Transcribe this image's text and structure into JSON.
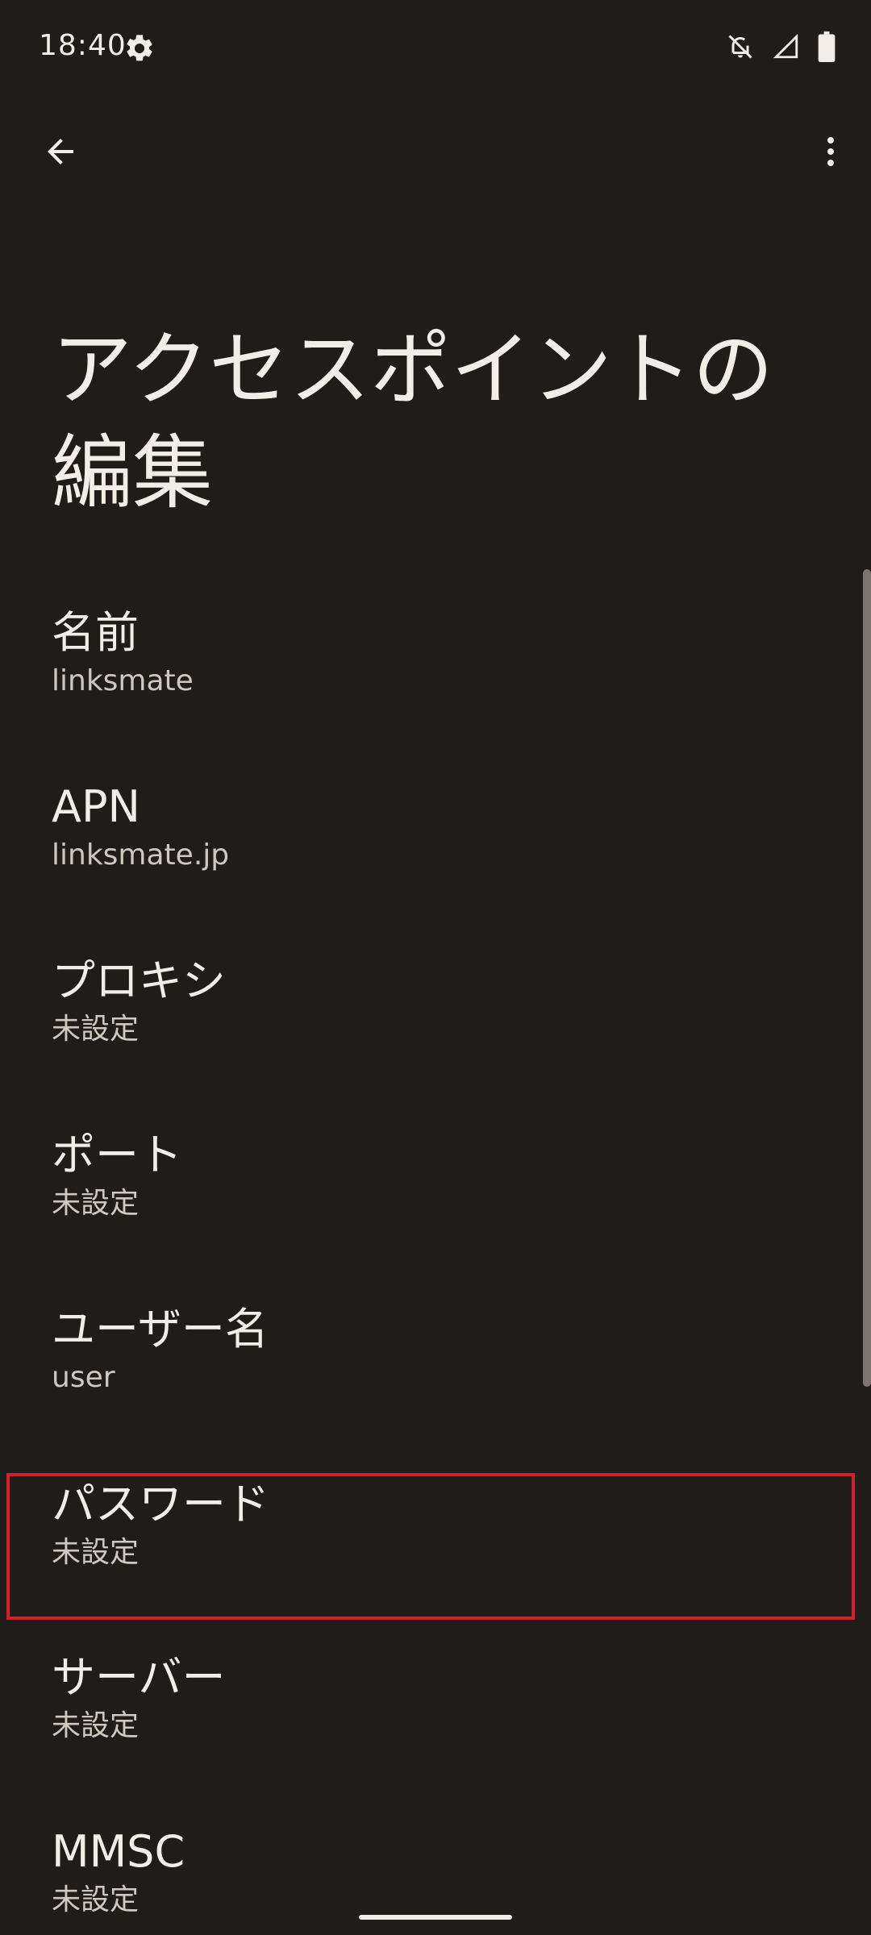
{
  "status_bar": {
    "time": "18:40",
    "icons": [
      "gear-icon",
      "notifications-off-icon",
      "signal-icon",
      "battery-icon"
    ]
  },
  "app_bar": {
    "back_icon": "arrow-back-icon",
    "more_icon": "more-vert-icon"
  },
  "page": {
    "title": "アクセスポイントの編集"
  },
  "preferences": [
    {
      "title": "名前",
      "summary": "linksmate"
    },
    {
      "title": "APN",
      "summary": "linksmate.jp"
    },
    {
      "title": "プロキシ",
      "summary": "未設定"
    },
    {
      "title": "ポート",
      "summary": "未設定"
    },
    {
      "title": "ユーザー名",
      "summary": "user"
    },
    {
      "title": "パスワード",
      "summary": "未設定",
      "highlighted": true
    },
    {
      "title": "サーバー",
      "summary": "未設定"
    },
    {
      "title": "MMSC",
      "summary": "未設定"
    }
  ],
  "colors": {
    "background": "#1f1c19",
    "text": "#f2ede7",
    "summary": "#cfc8c0",
    "highlight_border": "#d4202a"
  }
}
